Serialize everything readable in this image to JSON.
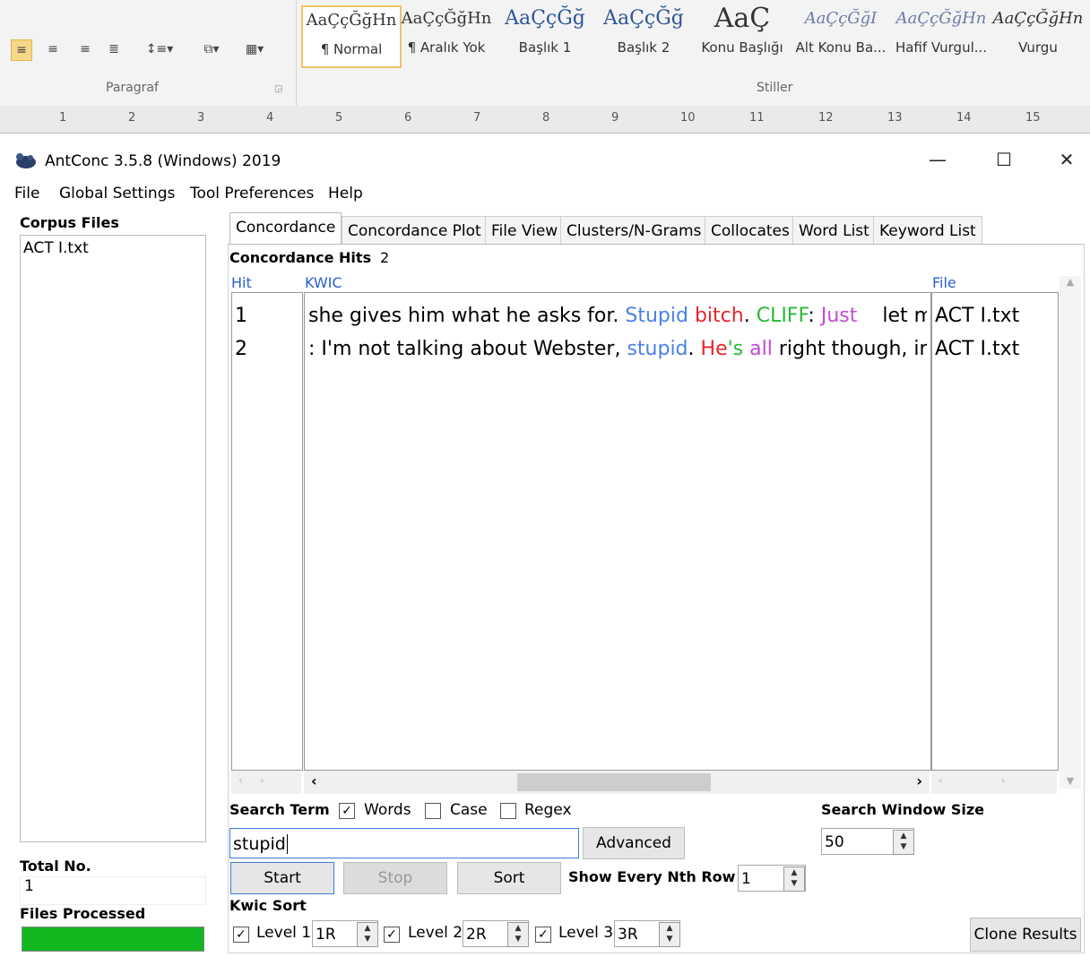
{
  "ribbon": {
    "paragraph_label": "Paragraf",
    "styles_label": "Stiller",
    "styles": [
      {
        "sample": "AaÇçĞğHn",
        "name": "¶ Normal"
      },
      {
        "sample": "AaÇçĞğHn",
        "name": "¶ Aralık Yok"
      },
      {
        "sample": "AaÇçĞğ",
        "name": "Başlık 1"
      },
      {
        "sample": "AaÇçĞğ",
        "name": "Başlık 2"
      },
      {
        "sample": "AaÇ",
        "name": "Konu Başlığı"
      },
      {
        "sample": "AaÇçĞğI",
        "name": "Alt Konu Ba..."
      },
      {
        "sample": "AaÇçĞğHn",
        "name": "Hafif Vurgul..."
      },
      {
        "sample": "AaÇçĞğHn",
        "name": "Vurgu"
      }
    ],
    "ruler_marks": [
      "1",
      "2",
      "3",
      "4",
      "5",
      "6",
      "7",
      "8",
      "9",
      "10",
      "11",
      "12",
      "13",
      "14",
      "15"
    ]
  },
  "window": {
    "title": "AntConc 3.5.8 (Windows) 2019",
    "minimize": "—",
    "maximize": "☐",
    "close": "✕"
  },
  "menu": [
    "File",
    "Global Settings",
    "Tool Preferences",
    "Help"
  ],
  "sidebar": {
    "corpus_files_label": "Corpus Files",
    "files": [
      "ACT I.txt"
    ],
    "total_no_label": "Total No.",
    "total_no_value": "1",
    "files_processed_label": "Files Processed",
    "progress": 1.0
  },
  "tabs": [
    "Concordance",
    "Concordance Plot",
    "File View",
    "Clusters/N-Grams",
    "Collocates",
    "Word List",
    "Keyword List"
  ],
  "concordance": {
    "hits_label": "Concordance Hits",
    "hits_value": "2",
    "col_hit": "Hit",
    "col_kwic": "KWIC",
    "col_file": "File",
    "rows": [
      {
        "hit": "1",
        "file": "ACT I.txt",
        "segments": [
          {
            "text": "she gives him what he asks for. ",
            "color": "default"
          },
          {
            "text": "Stupid",
            "color": "blue"
          },
          {
            "text": " ",
            "color": "default"
          },
          {
            "text": "bitch",
            "color": "red"
          },
          {
            "text": ". ",
            "color": "default"
          },
          {
            "text": "CLIFF",
            "color": "green"
          },
          {
            "text": ": ",
            "color": "default"
          },
          {
            "text": "Just",
            "color": "purple"
          },
          {
            "text": "    let me",
            "color": "default"
          }
        ]
      },
      {
        "hit": "2",
        "file": "ACT I.txt",
        "segments": [
          {
            "text": ": I'm not talking about Webster, ",
            "color": "default"
          },
          {
            "text": "stupid",
            "color": "blue"
          },
          {
            "text": ". ",
            "color": "default"
          },
          {
            "text": "He",
            "color": "red"
          },
          {
            "text": "'s ",
            "color": "green"
          },
          {
            "text": "all",
            "color": "purple"
          },
          {
            "text": " right though, in h",
            "color": "default"
          }
        ]
      }
    ]
  },
  "search": {
    "term_label": "Search Term",
    "words_label": "Words",
    "case_label": "Case",
    "regex_label": "Regex",
    "words_checked": true,
    "case_checked": false,
    "regex_checked": false,
    "value": "stupid",
    "advanced_label": "Advanced",
    "window_size_label": "Search Window Size",
    "window_size_value": "50",
    "start_label": "Start",
    "stop_label": "Stop",
    "sort_label": "Sort",
    "nth_row_label": "Show Every Nth Row",
    "nth_row_value": "1",
    "kwic_sort_label": "Kwic Sort",
    "level1_label": "Level 1",
    "level1_value": "1R",
    "level2_label": "Level 2",
    "level2_value": "2R",
    "level3_label": "Level 3",
    "level3_value": "3R",
    "clone_label": "Clone Results"
  },
  "colors": {
    "blue": "#4a80e8",
    "red": "#e3262b",
    "green": "#28b936",
    "purple": "#c34ad6",
    "header_blue": "#2b5fd0",
    "progress_green": "#12b61f"
  }
}
